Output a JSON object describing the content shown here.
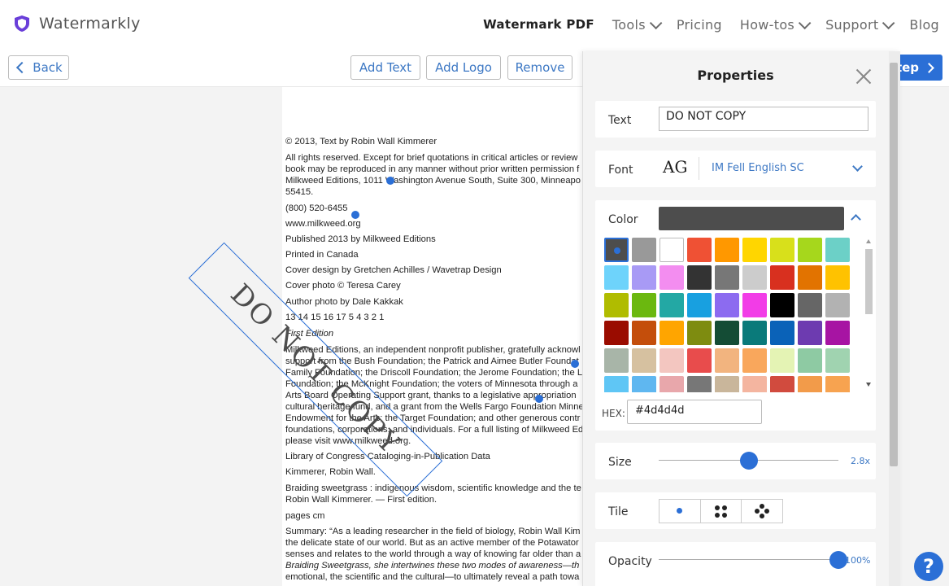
{
  "nav": {
    "brand": "Watermarkly",
    "items": [
      {
        "label": "Watermark PDF",
        "active": true,
        "dropdown": false
      },
      {
        "label": "Tools",
        "active": false,
        "dropdown": true
      },
      {
        "label": "Pricing",
        "active": false,
        "dropdown": false
      },
      {
        "label": "How-tos",
        "active": false,
        "dropdown": true
      },
      {
        "label": "Support",
        "active": false,
        "dropdown": true
      },
      {
        "label": "Blog",
        "active": false,
        "dropdown": false
      }
    ]
  },
  "toolbar": {
    "back_label": "Back",
    "add_text_label": "Add Text",
    "add_logo_label": "Add Logo",
    "remove_label": "Remove",
    "next_label": "tep"
  },
  "document": {
    "lines": [
      "© 2013, Text by Robin Wall Kimmerer",
      "All rights reserved. Except for brief quotations in critical articles or review",
      "book may be reproduced in any manner without prior written permission f",
      "Milkweed Editions, 1011 Washington Avenue South, Suite 300, Minneapo",
      "55415.",
      "(800) 520-6455",
      "www.milkweed.org",
      "Published 2013 by Milkweed Editions",
      "Printed in Canada",
      "Cover design by Gretchen Achilles / Wavetrap Design",
      "Cover photo © Teresa Carey",
      "Author photo by Dale Kakkak",
      "13 14 15 16 17 5 4 3 2 1",
      "First Edition",
      "Milkweed Editions, an independent nonprofit publisher, gratefully acknowl",
      "support from the Bush Foundation; the Patrick and Aimee Butler Foundat",
      "Family Foundation; the Driscoll Foundation; the Jerome Foundation; the L",
      "Foundation; the McKnight Foundation; the voters of Minnesota through a",
      "Arts Board Operating Support grant, thanks to a legislative appropriation",
      "cultural heritage fund, and a grant from the Wells Fargo Foundation Minne",
      "Endowment for the Arts; the Target Foundation; and other generous contr",
      "foundations, corporations, and individuals. For a full listing of Milkweed Ed",
      "please visit www.milkweed.org.",
      "Library of Congress Cataloging-in-Publication Data",
      "Kimmerer, Robin Wall.",
      "Braiding sweetgrass : indigenous wisdom, scientific knowledge and the te",
      "Robin Wall Kimmerer. — First edition.",
      "pages cm",
      "Summary: “As a leading researcher in the field of biology, Robin Wall Kim",
      "the delicate state of our world. But as an active member of the Potawator",
      "senses and relates to the world through a way of knowing far older than a",
      "Braiding Sweetgrass, she intertwines these two modes of awareness—th",
      "emotional, the scientific and the cultural—to ultimately reveal a path towa"
    ],
    "watermark_text": "DO NOT COPY"
  },
  "panel": {
    "title": "Properties",
    "text_label": "Text",
    "text_value": "DO NOT COPY",
    "font_label": "Font",
    "font_preview": "AG",
    "font_name": "IM Fell English SC",
    "color_label": "Color",
    "selected_color": "#4d4d4d",
    "hex_label": "HEX:",
    "hex_value": "#4d4d4d",
    "size_label": "Size",
    "size_value": "2.8x",
    "size_fraction": 0.5,
    "tile_label": "Tile",
    "opacity_label": "Opacity",
    "opacity_value": "100%",
    "opacity_fraction": 1.0,
    "palette": [
      "#4d4d4d",
      "#999999",
      "#ffffff",
      "#ef5134",
      "#ff9800",
      "#ffd600",
      "#d8e01b",
      "#a6d71c",
      "#6cd0c7",
      "#6ed3fb",
      "#a89af5",
      "#f38df0",
      "#333333",
      "#777777",
      "#cccccc",
      "#d8301f",
      "#e27300",
      "#ffc200",
      "#b0bc00",
      "#6bb80f",
      "#23a8a4",
      "#18a0e0",
      "#8c6bf0",
      "#f23ce7",
      "#000000",
      "#666666",
      "#b2b2b2",
      "#9a0c00",
      "#c44e0b",
      "#ffa500",
      "#7e8c10",
      "#144c35",
      "#0a7a7a",
      "#0a62b8",
      "#6d3bb0",
      "#a714a3",
      "#a8b5a8",
      "#d6c1a0",
      "#f3c6c0",
      "#e84c4c",
      "#f2b47f",
      "#f9a75c",
      "#e4f3b4",
      "#8ecaa3",
      "#a0d3b0",
      "#5fc6f5",
      "#5fb7f0",
      "#e8a7ab",
      "#777777",
      "#c9b69b",
      "#f4b5a0",
      "#d14b3e",
      "#f29b4a",
      "#f7a350"
    ]
  },
  "colors": {
    "accent": "#2b6fd6"
  }
}
